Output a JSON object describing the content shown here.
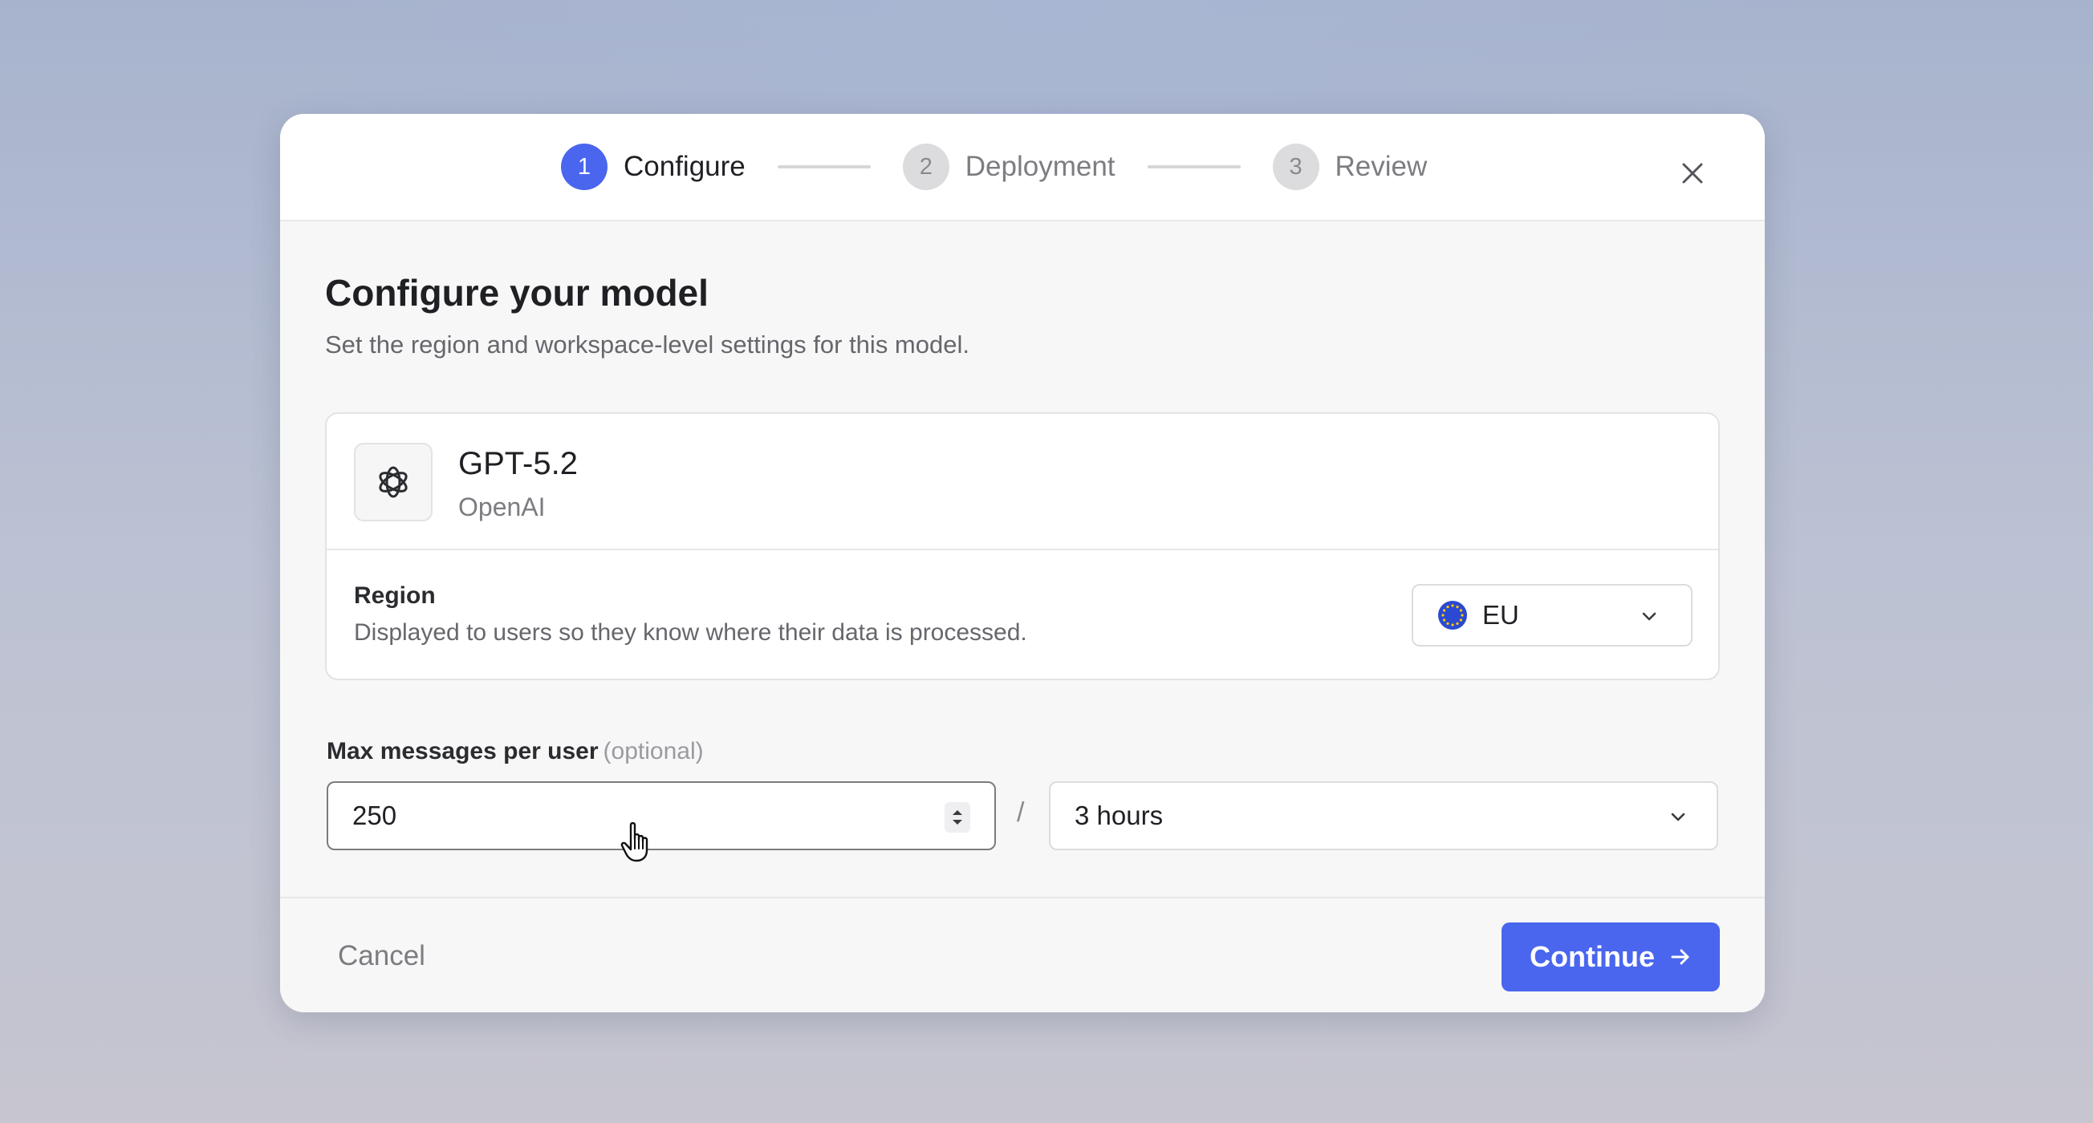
{
  "stepper": {
    "steps": [
      {
        "number": "1",
        "label": "Configure",
        "state": "active"
      },
      {
        "number": "2",
        "label": "Deployment",
        "state": "inactive"
      },
      {
        "number": "3",
        "label": "Review",
        "state": "inactive"
      }
    ]
  },
  "content": {
    "title": "Configure your model",
    "subtitle": "Set the region and workspace-level settings for this model."
  },
  "model": {
    "name": "GPT-5.2",
    "provider": "OpenAI",
    "icon": "openai-logo-icon"
  },
  "region": {
    "label": "Region",
    "help": "Displayed to users so they know where their data is processed.",
    "selected": "EU",
    "flag_icon": "eu-flag-icon"
  },
  "limits": {
    "label": "Max messages per user",
    "optional": "(optional)",
    "value": "250",
    "separator": "/",
    "period": "3 hours"
  },
  "footer": {
    "cancel_label": "Cancel",
    "continue_label": "Continue"
  },
  "colors": {
    "accent": "#4a66ee",
    "eu_blue": "#2b49d1"
  }
}
